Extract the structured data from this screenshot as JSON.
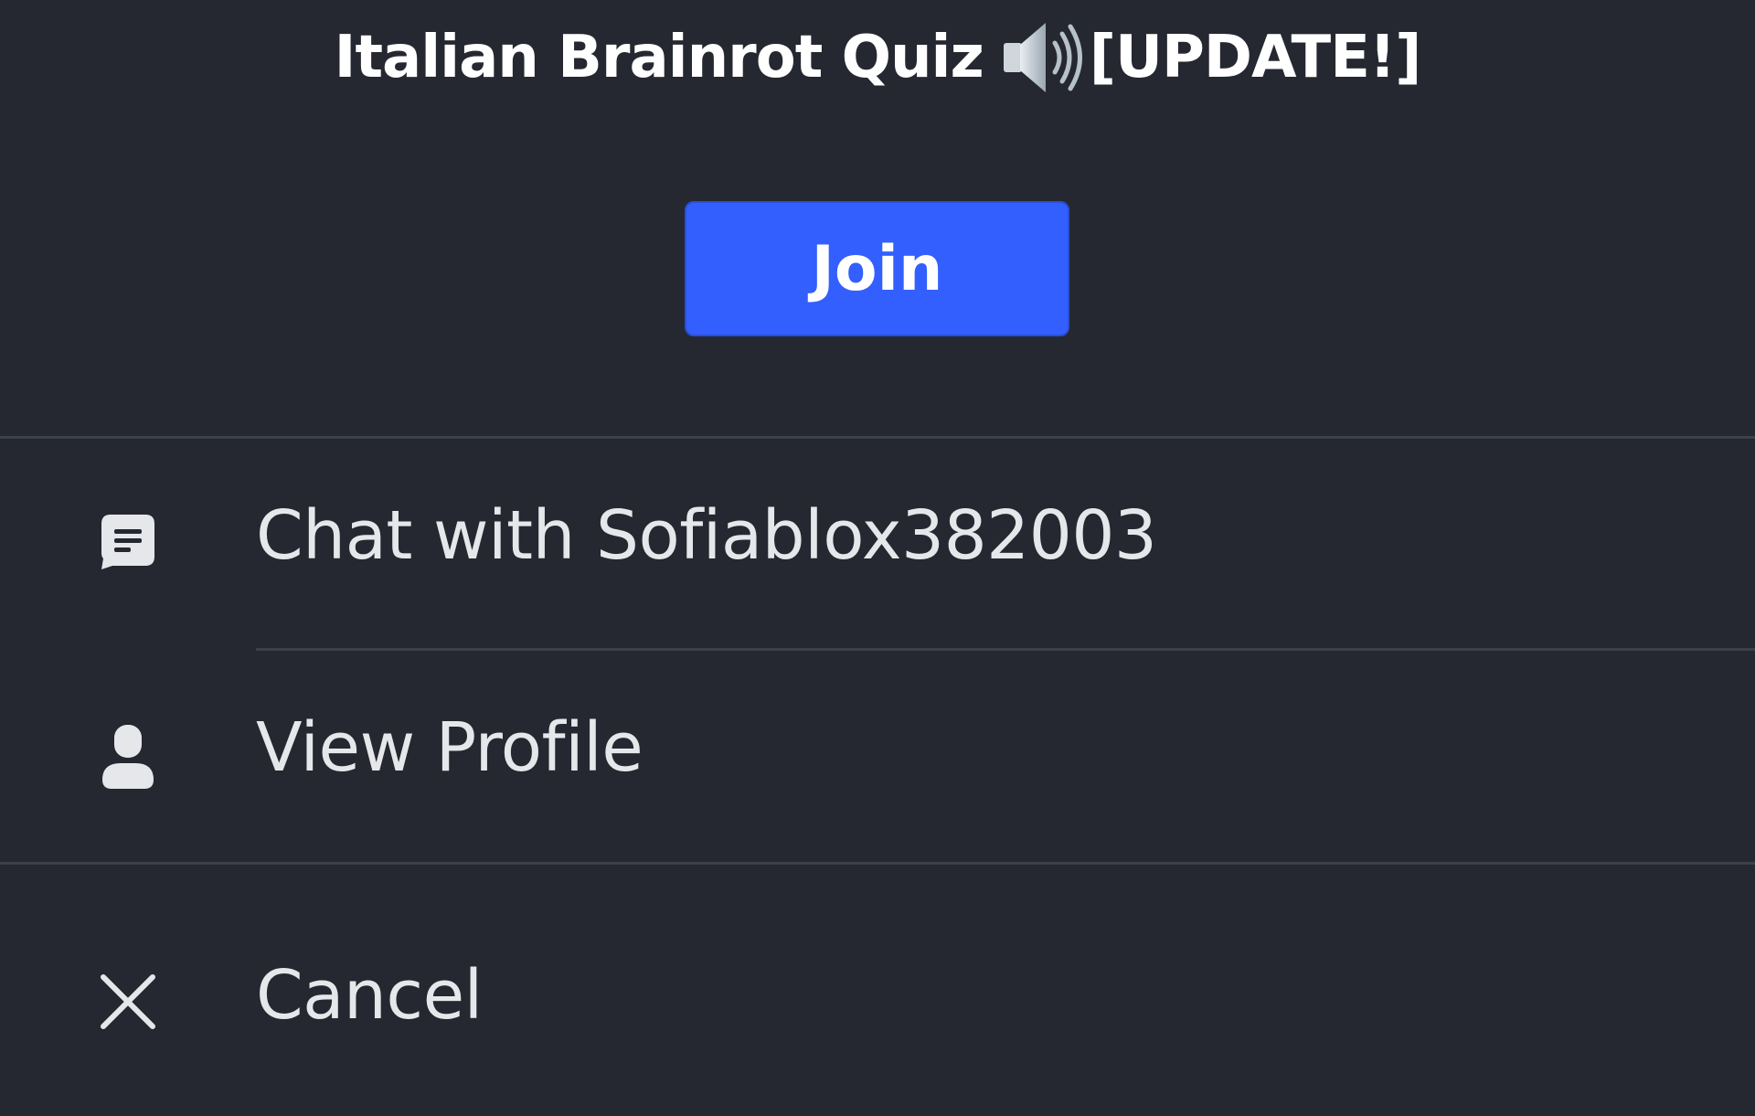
{
  "game": {
    "title": "Italian Brainrot Quiz",
    "title_icon": "speaker-icon",
    "title_suffix": "[UPDATE!]"
  },
  "join_button": {
    "label": "Join",
    "color": "#335fff"
  },
  "menu": {
    "items": [
      {
        "label": "Chat with Sofiablox382003",
        "icon": "chat-bubble-icon"
      },
      {
        "label": "View Profile",
        "icon": "person-icon"
      },
      {
        "label": "Cancel",
        "icon": "close-icon"
      }
    ]
  },
  "colors": {
    "background": "#252830",
    "divider": "#3c4049",
    "text": "#e6e7ea"
  }
}
